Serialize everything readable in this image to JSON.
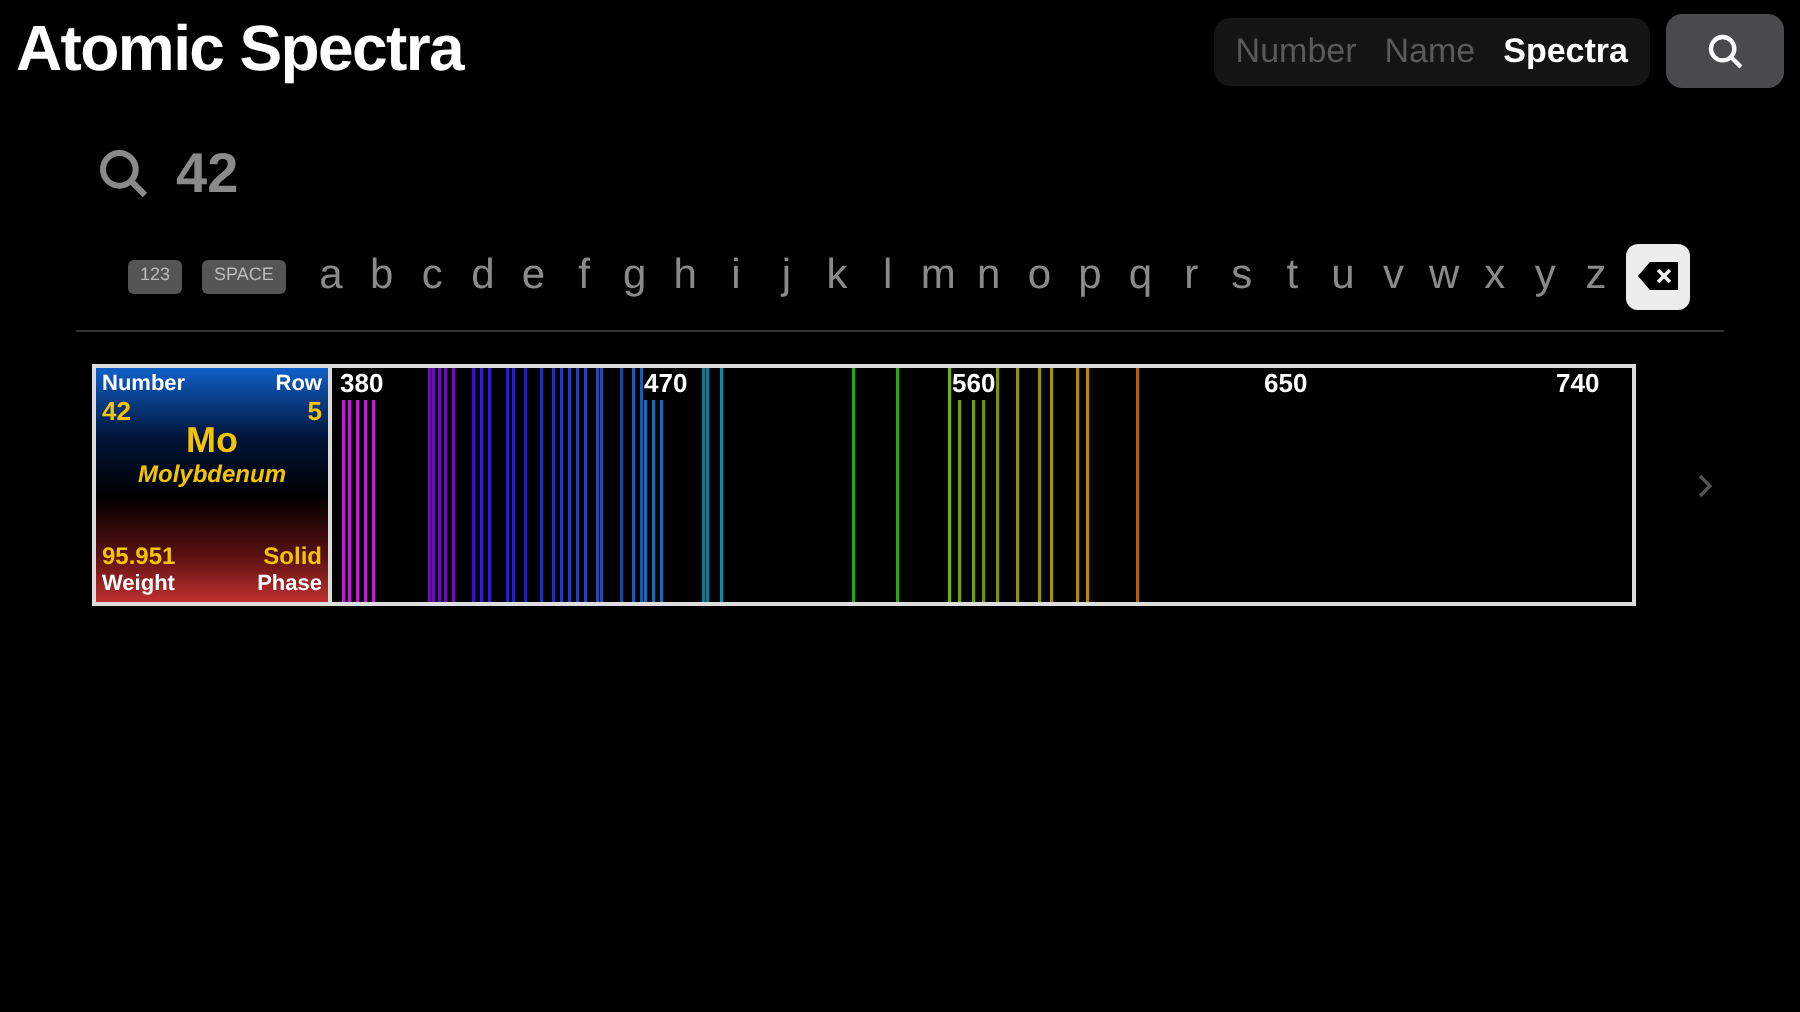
{
  "title": "Atomic Spectra",
  "segments": [
    {
      "label": "Number",
      "selected": false
    },
    {
      "label": "Name",
      "selected": false
    },
    {
      "label": "Spectra",
      "selected": true
    }
  ],
  "search": {
    "value": "42"
  },
  "keyboard": [
    {
      "label": "123",
      "kind": "chip"
    },
    {
      "label": "SPACE",
      "kind": "chip"
    },
    {
      "label": "a",
      "kind": "letter"
    },
    {
      "label": "b",
      "kind": "letter"
    },
    {
      "label": "c",
      "kind": "letter"
    },
    {
      "label": "d",
      "kind": "letter"
    },
    {
      "label": "e",
      "kind": "letter"
    },
    {
      "label": "f",
      "kind": "letter"
    },
    {
      "label": "g",
      "kind": "letter"
    },
    {
      "label": "h",
      "kind": "letter"
    },
    {
      "label": "i",
      "kind": "letter"
    },
    {
      "label": "j",
      "kind": "letter"
    },
    {
      "label": "k",
      "kind": "letter"
    },
    {
      "label": "l",
      "kind": "letter"
    },
    {
      "label": "m",
      "kind": "letter"
    },
    {
      "label": "n",
      "kind": "letter"
    },
    {
      "label": "o",
      "kind": "letter"
    },
    {
      "label": "p",
      "kind": "letter"
    },
    {
      "label": "q",
      "kind": "letter"
    },
    {
      "label": "r",
      "kind": "letter"
    },
    {
      "label": "s",
      "kind": "letter"
    },
    {
      "label": "t",
      "kind": "letter"
    },
    {
      "label": "u",
      "kind": "letter"
    },
    {
      "label": "v",
      "kind": "letter"
    },
    {
      "label": "w",
      "kind": "letter"
    },
    {
      "label": "x",
      "kind": "letter"
    },
    {
      "label": "y",
      "kind": "letter"
    },
    {
      "label": "z",
      "kind": "letter"
    },
    {
      "kind": "delete"
    }
  ],
  "element": {
    "number_label": "Number",
    "number": "42",
    "row_label": "Row",
    "row": "5",
    "symbol": "Mo",
    "name": "Molybdenum",
    "weight": "95.951",
    "weight_label": "Weight",
    "phase": "Solid",
    "phase_label": "Phase"
  },
  "spectrum": {
    "ticks": [
      "380",
      "470",
      "560",
      "650",
      "740"
    ]
  }
}
